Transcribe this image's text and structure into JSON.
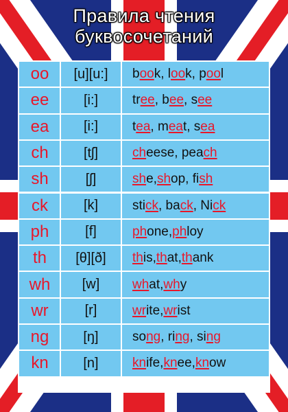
{
  "colors": {
    "flag_blue": "#1b2f86",
    "flag_red": "#e41e26",
    "flag_white": "#ffffff",
    "table_blue": "#72c8f0",
    "accent_red": "#e8172a"
  },
  "title": [
    "Правила чтения",
    "буквосочетаний"
  ],
  "rules": [
    {
      "combo": "oo",
      "sound": "[u][u:]",
      "examples": [
        [
          {
            "t": "b"
          },
          {
            "t": "oo",
            "hl": true
          },
          {
            "t": "k, l"
          },
          {
            "t": "oo",
            "hl": true
          },
          {
            "t": "k, p"
          },
          {
            "t": "oo",
            "hl": true
          },
          {
            "t": "l"
          }
        ]
      ]
    },
    {
      "combo": "ee",
      "sound": "[i:]",
      "examples": [
        [
          {
            "t": "tr"
          },
          {
            "t": "ee",
            "hl": true
          },
          {
            "t": ", b"
          },
          {
            "t": "ee",
            "hl": true
          },
          {
            "t": ", s"
          },
          {
            "t": "ee",
            "hl": true
          }
        ]
      ]
    },
    {
      "combo": "ea",
      "sound": "[i:]",
      "examples": [
        [
          {
            "t": "t"
          },
          {
            "t": "ea",
            "hl": true
          },
          {
            "t": ", m"
          },
          {
            "t": "ea",
            "hl": true
          },
          {
            "t": "t, s"
          },
          {
            "t": "ea",
            "hl": true
          }
        ]
      ]
    },
    {
      "combo": "ch",
      "sound": "[tʃ]",
      "examples": [
        [
          {
            "t": "ch",
            "hl": true
          },
          {
            "t": "eese, pea"
          },
          {
            "t": "ch",
            "hl": true
          }
        ]
      ]
    },
    {
      "combo": "sh",
      "sound": "[ʃ]",
      "examples": [
        [
          {
            "t": "sh",
            "hl": true
          },
          {
            "t": "e, "
          },
          {
            "t": "sh",
            "hl": true
          },
          {
            "t": "op, fi"
          },
          {
            "t": "sh",
            "hl": true
          }
        ]
      ]
    },
    {
      "combo": "ck",
      "sound": "[k]",
      "examples": [
        [
          {
            "t": "sti"
          },
          {
            "t": "ck",
            "hl": true
          },
          {
            "t": ", ba"
          },
          {
            "t": "ck",
            "hl": true
          },
          {
            "t": ", Ni"
          },
          {
            "t": "ck",
            "hl": true
          }
        ]
      ]
    },
    {
      "combo": "ph",
      "sound": "[f]",
      "examples": [
        [
          {
            "t": "ph",
            "hl": true
          },
          {
            "t": "one, "
          },
          {
            "t": "ph",
            "hl": true
          },
          {
            "t": "loy"
          }
        ]
      ]
    },
    {
      "combo": "th",
      "sound": "[θ][ð]",
      "examples": [
        [
          {
            "t": "th",
            "hl": true
          },
          {
            "t": "is, "
          },
          {
            "t": "th",
            "hl": true
          },
          {
            "t": "at, "
          },
          {
            "t": "th",
            "hl": true
          },
          {
            "t": "ank"
          }
        ]
      ]
    },
    {
      "combo": "wh",
      "sound": "[w]",
      "examples": [
        [
          {
            "t": "wh",
            "hl": true
          },
          {
            "t": "at, "
          },
          {
            "t": "wh",
            "hl": true
          },
          {
            "t": "y"
          }
        ]
      ]
    },
    {
      "combo": "wr",
      "sound": "[r]",
      "examples": [
        [
          {
            "t": "wr",
            "hl": true
          },
          {
            "t": "ite, "
          },
          {
            "t": "wr",
            "hl": true
          },
          {
            "t": "ist"
          }
        ]
      ]
    },
    {
      "combo": "ng",
      "sound": "[ŋ]",
      "examples": [
        [
          {
            "t": "so"
          },
          {
            "t": "ng",
            "hl": true
          },
          {
            "t": ", ri"
          },
          {
            "t": "ng",
            "hl": true
          },
          {
            "t": ", si"
          },
          {
            "t": "ng",
            "hl": true
          }
        ]
      ]
    },
    {
      "combo": "kn",
      "sound": "[n]",
      "examples": [
        [
          {
            "t": "kn",
            "hl": true
          },
          {
            "t": "ife, "
          },
          {
            "t": "kn",
            "hl": true
          },
          {
            "t": "ee, "
          },
          {
            "t": "kn",
            "hl": true
          },
          {
            "t": "ow"
          }
        ]
      ]
    }
  ]
}
